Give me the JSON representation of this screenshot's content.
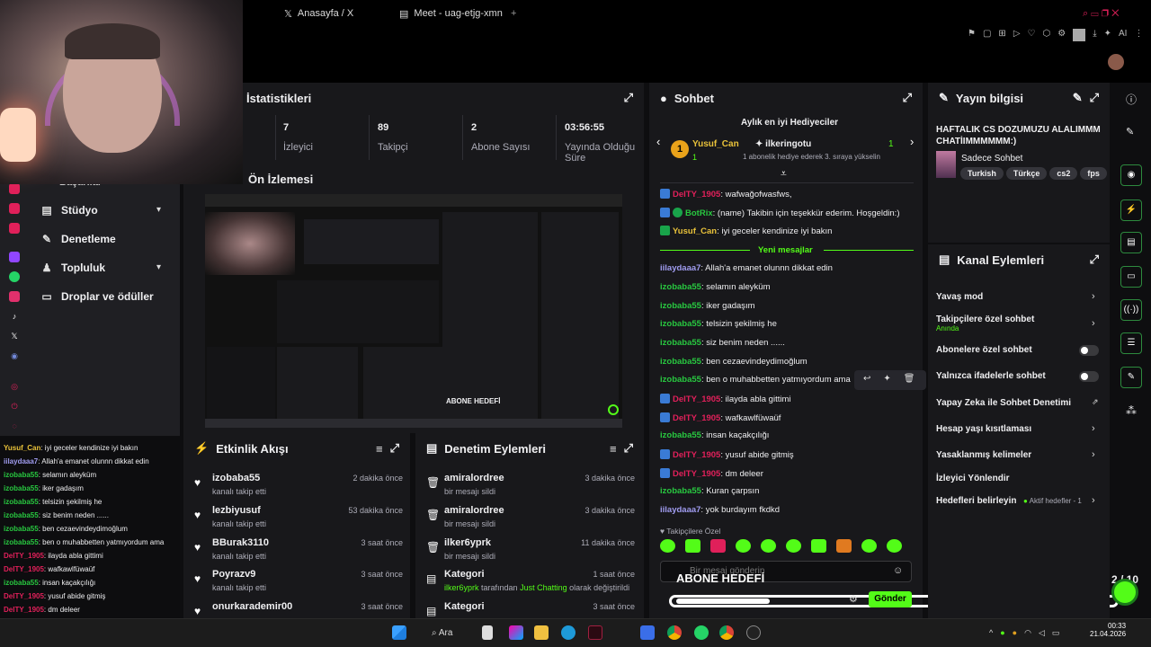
{
  "browser": {
    "tabs": [
      "Anasayfa / X",
      "Meet - uag-etjg-xmn"
    ],
    "new_tab": "+",
    "ai_label": "AI"
  },
  "stats": {
    "title": "İstatistikleri",
    "items": [
      {
        "value": "7",
        "label": "İzleyici"
      },
      {
        "value": "89",
        "label": "Takipçi"
      },
      {
        "value": "2",
        "label": "Abone Sayısı"
      },
      {
        "value": "03:56:55",
        "label": "Yayında Olduğu Süre"
      }
    ]
  },
  "preview": {
    "title": "Ön İzlemesi",
    "goal_label": "ABONE HEDEFİ"
  },
  "sidebar": {
    "partial_item": "Başarılar",
    "items": [
      {
        "label": "Stüdyo",
        "icon": "studio-icon",
        "expandable": true
      },
      {
        "label": "Denetleme",
        "icon": "wrench-icon",
        "expandable": false
      },
      {
        "label": "Topluluk",
        "icon": "community-icon",
        "expandable": true
      },
      {
        "label": "Droplar ve ödüller",
        "icon": "gift-icon",
        "expandable": false
      }
    ]
  },
  "activity": {
    "title": "Etkinlik Akışı",
    "items": [
      {
        "name": "izobaba55",
        "sub": "kanalı takip etti",
        "time": "2 dakika önce"
      },
      {
        "name": "lezbiyusuf",
        "sub": "kanalı takip etti",
        "time": "53 dakika önce"
      },
      {
        "name": "BBurak3110",
        "sub": "kanalı takip etti",
        "time": "3 saat önce"
      },
      {
        "name": "Poyrazv9",
        "sub": "kanalı takip etti",
        "time": "3 saat önce"
      },
      {
        "name": "onurkarademir00",
        "sub": "",
        "time": "3 saat önce"
      }
    ]
  },
  "moderation": {
    "title": "Denetim Eylemleri",
    "items": [
      {
        "name": "amiralordree",
        "sub": "bir mesajı sildi",
        "time": "3 dakika önce"
      },
      {
        "name": "amiralordree",
        "sub": "bir mesajı sildi",
        "time": "3 dakika önce"
      },
      {
        "name": "ilker6yprk",
        "sub": "bir mesajı sildi",
        "time": "11 dakika önce"
      },
      {
        "name": "Kategori",
        "sub_user": "ilker6yprk",
        "sub_mid": " tarafından ",
        "sub_cat": "Just Chatting",
        "sub_end": " olarak değiştirildi",
        "time": "1 saat önce"
      },
      {
        "name": "Kategori",
        "sub": "",
        "time": "3 saat önce"
      }
    ]
  },
  "chat": {
    "title": "Sohbet",
    "top_gifters_title": "Aylık en iyi Hediyeciler",
    "gifter1": {
      "name": "Yusuf_Can",
      "count": "1",
      "rank": "1"
    },
    "gifter2": {
      "name": "ilkeringotu",
      "note": "1 abonelik hediye ederek 3. sıraya yükselin"
    },
    "new_messages": "Yeni mesajlar",
    "messages": [
      {
        "user": "DeITY_1905",
        "text": ": wafwağofwasfws,",
        "color": "#e0205a",
        "badge": "blue"
      },
      {
        "user": "BotRix",
        "text": ": (name) Takibin için teşekkür ederim. Hoşgeldin:)",
        "color": "#28c840",
        "badge": "both"
      },
      {
        "user": "Yusuf_Can",
        "text": ": iyi geceler kendinize iyi bakın",
        "color": "#e9c23a",
        "badge": "green"
      },
      {
        "user": "iilaydaaa7",
        "text": ": Allah'a emanet olunnn dikkat edin",
        "color": "#a09cf0",
        "badge": ""
      },
      {
        "user": "izobaba55",
        "text": ": selamın aleyküm",
        "color": "#28c840",
        "badge": ""
      },
      {
        "user": "izobaba55",
        "text": ": iker gadaşım",
        "color": "#28c840",
        "badge": ""
      },
      {
        "user": "izobaba55",
        "text": ": telsizin şekilmiş he",
        "color": "#28c840",
        "badge": ""
      },
      {
        "user": "izobaba55",
        "text": ": siz benim neden ......",
        "color": "#28c840",
        "badge": ""
      },
      {
        "user": "izobaba55",
        "text": ": ben cezaevindeydimoğlum",
        "color": "#28c840",
        "badge": ""
      },
      {
        "user": "izobaba55",
        "text": ": ben o muhabbetten yatmıyordum ama",
        "color": "#28c840",
        "badge": ""
      },
      {
        "user": "DeITY_1905",
        "text": ": ilayda abla gittimi",
        "color": "#e0205a",
        "badge": "blue"
      },
      {
        "user": "DeITY_1905",
        "text": ": wafkawlfüwaüf",
        "color": "#e0205a",
        "badge": "blue"
      },
      {
        "user": "izobaba55",
        "text": ": insan kaçakçılığı",
        "color": "#28c840",
        "badge": ""
      },
      {
        "user": "DeITY_1905",
        "text": ": yusuf abide gitmiş",
        "color": "#e0205a",
        "badge": "blue"
      },
      {
        "user": "DeITY_1905",
        "text": ": dm deleer",
        "color": "#e0205a",
        "badge": "blue"
      },
      {
        "user": "izobaba55",
        "text": ": Kuran çarpsın",
        "color": "#28c840",
        "badge": ""
      },
      {
        "user": "iilaydaaa7",
        "text": ": yok burdayım fkdkd",
        "color": "#a09cf0",
        "badge": ""
      }
    ],
    "followers_only": "Takipçilere Özel",
    "input_placeholder": "Bir mesaj gönderin",
    "goal_overlay": "ABONE HEDEFİ",
    "goal_count": "2 / 10",
    "send_label": "Gönder"
  },
  "stream_info": {
    "title": "Yayın bilgisi",
    "stream_title": "HAFTALIK CS DOZUMUZU ALALIMMM CHATİIMMMMMM:)",
    "category": "Sadece Sohbet",
    "tags": [
      "Turkish",
      "Türkçe",
      "cs2",
      "fps"
    ]
  },
  "channel_actions": {
    "title": "Kanal Eylemleri",
    "items": [
      {
        "label": "Yavaş mod",
        "control": "chevron"
      },
      {
        "label": "Takipçilere özel sohbet",
        "sub": "Anında",
        "control": "chevron"
      },
      {
        "label": "Abonelere özel sohbet",
        "control": "toggle"
      },
      {
        "label": "Yalnızca ifadelerle sohbet",
        "control": "toggle"
      },
      {
        "label": "Yapay Zeka ile Sohbet Denetimi",
        "control": "external"
      },
      {
        "label": "Hesap yaşı kısıtlaması",
        "control": "chevron"
      },
      {
        "label": "Yasaklanmış kelimeler",
        "control": "chevron"
      },
      {
        "label": "İzleyici Yönlendir",
        "control": "none"
      },
      {
        "label": "Hedefleri belirleyin",
        "sub_right": "Aktif hedefler - 1",
        "control": "chevron"
      }
    ]
  },
  "left_chat": [
    {
      "user": "Yusuf_Can",
      "text": ": iyi geceler kendinize iyi bakın",
      "color": "#e9c23a"
    },
    {
      "user": "iilaydaaa7",
      "text": ": Allah'a emanet olunnn dikkat edin",
      "color": "#a09cf0"
    },
    {
      "user": "izobaba55",
      "text": ": selamın aleyküm",
      "color": "#28c840"
    },
    {
      "user": "izobaba55",
      "text": ": iker gadaşım",
      "color": "#28c840"
    },
    {
      "user": "izobaba55",
      "text": ": telsizin şekilmiş he",
      "color": "#28c840"
    },
    {
      "user": "izobaba55",
      "text": ": siz benim neden ......",
      "color": "#28c840"
    },
    {
      "user": "izobaba55",
      "text": ": ben cezaevindeydimoğlum",
      "color": "#28c840"
    },
    {
      "user": "izobaba55",
      "text": ": ben o muhabbetten yatmıyordum ama",
      "color": "#28c840"
    },
    {
      "user": "DeITY_1905",
      "text": ": ilayda abla gittimi",
      "color": "#e0205a"
    },
    {
      "user": "DeITY_1905",
      "text": ": wafkawlfüwaüf",
      "color": "#e0205a"
    },
    {
      "user": "izobaba55",
      "text": ": insan kaçakçılığı",
      "color": "#28c840"
    },
    {
      "user": "DeITY_1905",
      "text": ": yusuf abide gitmiş",
      "color": "#e0205a"
    },
    {
      "user": "DeITY_1905",
      "text": ": dm deleer",
      "color": "#e0205a"
    }
  ],
  "taskbar": {
    "search_label": "Ara",
    "time": "00:33",
    "date": "21.04.2026"
  },
  "colors": {
    "accent": "#53fc18",
    "panel": "#18181b",
    "bg": "#0e0e10"
  }
}
